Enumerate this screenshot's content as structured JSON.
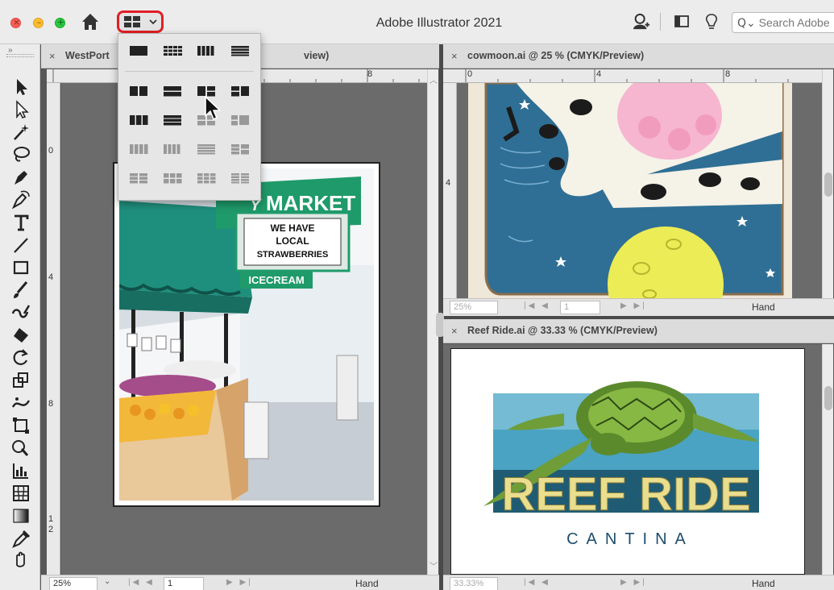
{
  "titlebar": {
    "app_title": "Adobe Illustrator 2021",
    "search_placeholder": "Search Adobe",
    "traffic_red": "×",
    "traffic_yellow": "–",
    "traffic_green": "+"
  },
  "panels": {
    "left": {
      "tab_close": "×",
      "tab_title": "WestPort",
      "tab_title_tail": "view)",
      "ruler_marks": [
        "8"
      ],
      "ruler_v_marks": [
        "0",
        "4",
        "8",
        "1",
        "2"
      ],
      "zoom": "25%",
      "page": "1",
      "tool_status": "Hand"
    },
    "top_right": {
      "tab_close": "×",
      "tab_title": "cowmoon.ai @ 25 % (CMYK/Preview)",
      "ruler_marks": [
        "0",
        "4",
        "8"
      ],
      "ruler_v_marks": [
        "4"
      ],
      "zoom": "25%",
      "page": "1",
      "tool_status": "Hand"
    },
    "bottom_right": {
      "tab_close": "×",
      "tab_title": "Reef Ride.ai @ 33.33 % (CMYK/Preview)",
      "zoom": "33.33%",
      "tool_status": "Hand"
    }
  },
  "artwork": {
    "market_sign": "MARKET",
    "market_prefix": "Y",
    "board_line1": "WE HAVE",
    "board_line2": "LOCAL",
    "board_line3": "STRAWBERRIES",
    "icecream": "ICECREAM",
    "reef_title": "REEF RIDE",
    "reef_sub": "CANTINA"
  },
  "colors": {
    "accent_red": "#e21e26",
    "market_green": "#1f9a6a",
    "cow_blue": "#2f6f95",
    "moon_yellow": "#ecec56",
    "reef_tan": "#e9dd8e",
    "reef_navy": "#1e4d6e"
  }
}
